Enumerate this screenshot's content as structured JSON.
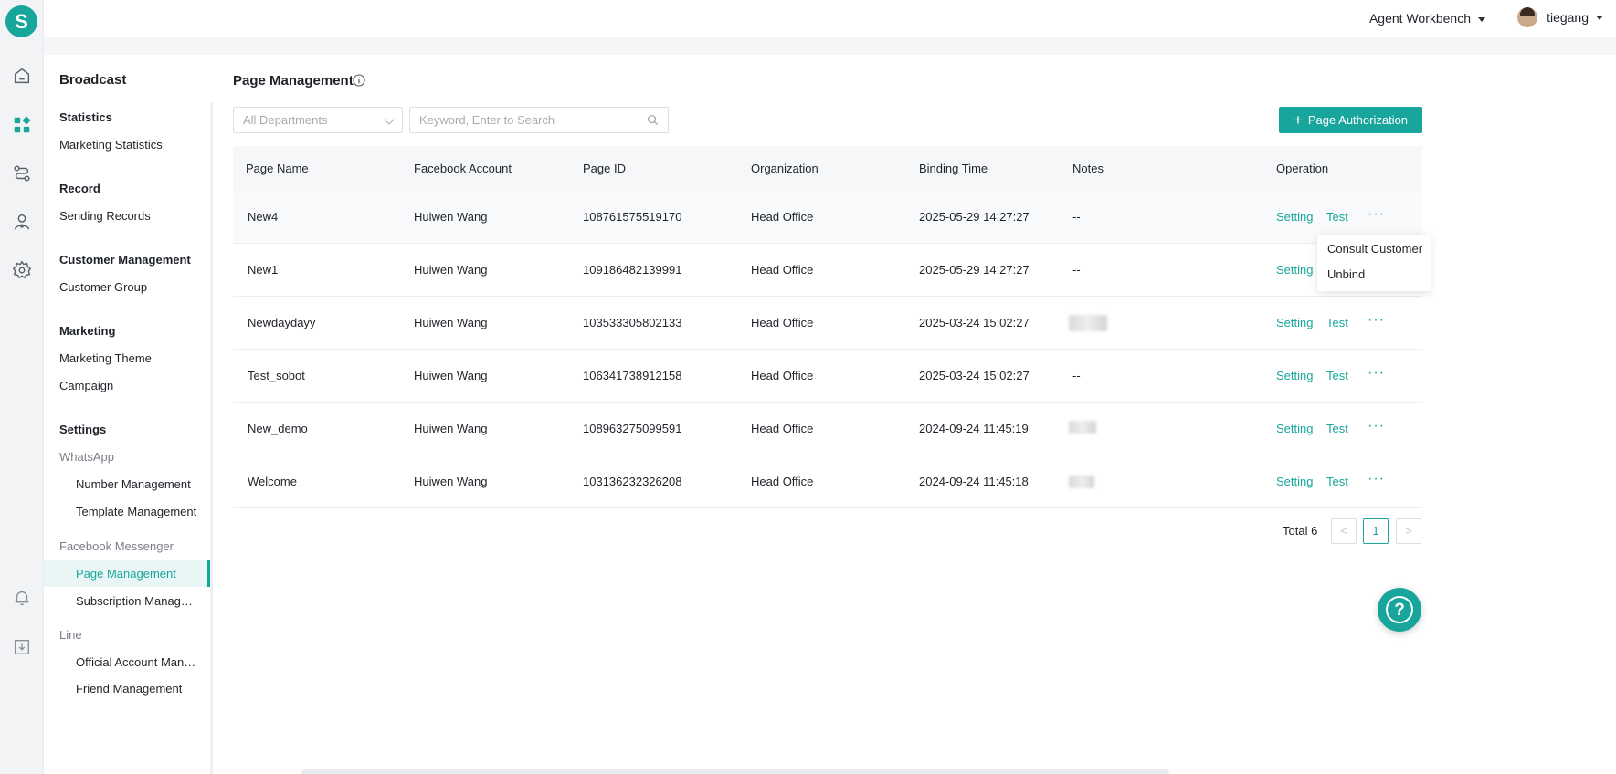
{
  "app": {
    "logo_letter": "S",
    "accent_color": "#18a59b"
  },
  "rail": {
    "icons": [
      "home-icon",
      "apps-icon",
      "routing-icon",
      "agent-icon",
      "settings-icon",
      "bell-icon",
      "download-icon"
    ]
  },
  "topbar": {
    "workbench_label": "Agent Workbench",
    "username": "tiegang"
  },
  "sidebar": {
    "title": "Broadcast",
    "groups": {
      "statistics": "Statistics",
      "record": "Record",
      "customer_management": "Customer Management",
      "marketing": "Marketing",
      "settings": "Settings"
    },
    "items": {
      "marketing_statistics": "Marketing Statistics",
      "sending_records": "Sending Records",
      "customer_group": "Customer Group",
      "marketing_theme": "Marketing Theme",
      "campaign": "Campaign",
      "whatsapp": "WhatsApp",
      "number_management": "Number Management",
      "template_management": "Template Management",
      "facebook_messenger": "Facebook Messenger",
      "page_management": "Page Management",
      "subscription_management": "Subscription Management",
      "line": "Line",
      "official_account_management": "Official Account Management",
      "friend_management": "Friend Management"
    }
  },
  "main": {
    "title": "Page Management",
    "dept_select": "All Departments",
    "search_placeholder": "Keyword, Enter to Search",
    "auth_button": "Page Authorization",
    "columns": [
      "Page Name",
      "Facebook Account",
      "Page ID",
      "Organization",
      "Binding Time",
      "Notes",
      "Operation"
    ],
    "rows": [
      {
        "name": "New4",
        "account": "Huiwen Wang",
        "page_id": "108761575519170",
        "org": "Head Office",
        "time": "2025-05-29 14:27:27",
        "notes": "--"
      },
      {
        "name": "New1",
        "account": "Huiwen Wang",
        "page_id": "109186482139991",
        "org": "Head Office",
        "time": "2025-05-29 14:27:27",
        "notes": "--"
      },
      {
        "name": "Newdaydayy",
        "account": "Huiwen Wang",
        "page_id": "103533305802133",
        "org": "Head Office",
        "time": "2025-03-24 15:02:27",
        "notes": ""
      },
      {
        "name": "Test_sobot",
        "account": "Huiwen Wang",
        "page_id": "106341738912158",
        "org": "Head Office",
        "time": "2025-03-24 15:02:27",
        "notes": "--"
      },
      {
        "name": "New_demo",
        "account": "Huiwen Wang",
        "page_id": "108963275099591",
        "org": "Head Office",
        "time": "2024-09-24 11:45:19",
        "notes": ""
      },
      {
        "name": "Welcome",
        "account": "Huiwen Wang",
        "page_id": "103136232326208",
        "org": "Head Office",
        "time": "2024-09-24 11:45:18",
        "notes": ""
      }
    ],
    "op_setting": "Setting",
    "op_test": "Test",
    "op_more": "···",
    "dropdown": {
      "consult": "Consult Customer",
      "unbind": "Unbind"
    },
    "pagination": {
      "total": "Total 6",
      "current": "1",
      "prev": "<",
      "next": ">"
    },
    "help_glyph": "?"
  }
}
